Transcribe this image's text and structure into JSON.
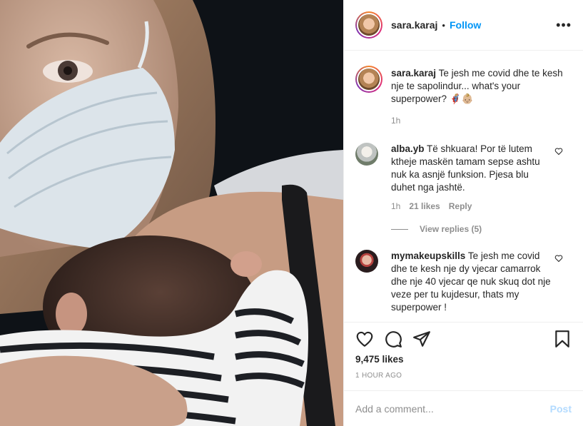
{
  "header": {
    "username": "sara.karaj",
    "separator": "•",
    "follow_label": "Follow",
    "more_icon": "more-options-icon",
    "more_label": "•••"
  },
  "caption": {
    "username": "sara.karaj",
    "text": "Te jesh me covid dhe te kesh nje te sapolindur... what's your superpower? ",
    "emoji": "🦸🏼‍♀️👶🏼",
    "time": "1h"
  },
  "comments": [
    {
      "username": "alba.yb",
      "text": "Të shkuara! Por të lutem ktheje maskën tamam sepse ashtu nuk ka asnjë funksion. Pjesa blu duhet nga jashtë.",
      "time": "1h",
      "likes": "21 likes",
      "reply_label": "Reply",
      "view_replies": "View replies (5)"
    },
    {
      "username": "mymakeupskills",
      "text": "Te jesh me covid dhe te kesh nje dy vjecar camarrok dhe nje 40 vjecar qe nuk skuq dot nje veze per tu kujdesur, thats my superpower !"
    }
  ],
  "actions": {
    "like_icon": "heart-icon",
    "comment_icon": "comment-icon",
    "share_icon": "share-icon",
    "save_icon": "bookmark-icon"
  },
  "likes": "9,475 likes",
  "posted_time": "1 HOUR AGO",
  "add_comment": {
    "placeholder": "Add a comment...",
    "post_label": "Post"
  },
  "colors": {
    "link_blue": "#0095f6",
    "post_disabled": "#b3dbff",
    "muted": "#8e8e8e",
    "text": "#262626"
  }
}
